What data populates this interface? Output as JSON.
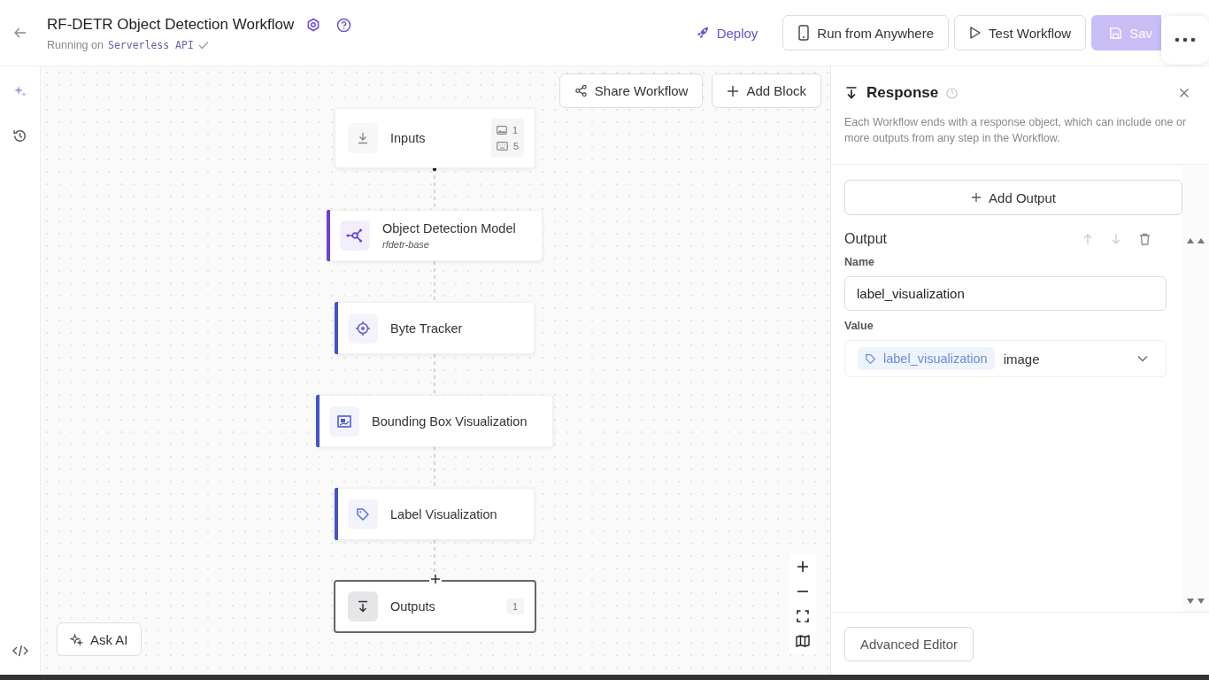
{
  "header": {
    "title": "RF-DETR Object Detection Workflow",
    "subtitle": "Running on",
    "runtime": "Serverless API",
    "verified": true
  },
  "actions": [
    {
      "kind": "link",
      "label": "Deploy",
      "disabled": false
    },
    {
      "kind": "outline",
      "label": "Run from Anywhere",
      "disabled": false
    },
    {
      "kind": "outline",
      "label": "Test Workflow",
      "disabled": false
    },
    {
      "kind": "primary",
      "label": "Sav",
      "disabled": true
    }
  ],
  "canvas": {
    "toolbar": [
      {
        "label": "Share Workflow"
      },
      {
        "label": "Add Block"
      }
    ],
    "nodes": [
      {
        "kind": "input",
        "label": "Inputs",
        "selected": false,
        "badges": [
          {
            "count": "1"
          },
          {
            "count": "5"
          }
        ]
      },
      {
        "kind": "model",
        "label": "Object Detection Model",
        "subtitle": "rfdetr-base",
        "color": "#6b3fd4",
        "selected": false
      },
      {
        "kind": "tracker",
        "label": "Byte Tracker",
        "color": "#4353c9",
        "selected": false
      },
      {
        "kind": "box_visualization",
        "label": "Bounding Box Visualization",
        "color": "#4353c9",
        "selected": false
      },
      {
        "kind": "label_visualization",
        "label": "Label Visualization",
        "color": "#4353c9",
        "selected": false
      },
      {
        "kind": "output",
        "label": "Outputs",
        "selected": true,
        "badges": [
          {
            "count": "1"
          }
        ]
      }
    ],
    "assistant_button": "Ask AI"
  },
  "panel": {
    "title": "Response",
    "description": "Each Workflow ends with a response object, which can include one or more outputs from any step in the Workflow.",
    "add_button": "Add Output",
    "output": {
      "heading": "Output",
      "name_label": "Name",
      "name_value": "label_visualization",
      "value_label": "Value",
      "value_tag": "label_visualization",
      "value_type": "image"
    },
    "footer_button": "Advanced Editor"
  }
}
